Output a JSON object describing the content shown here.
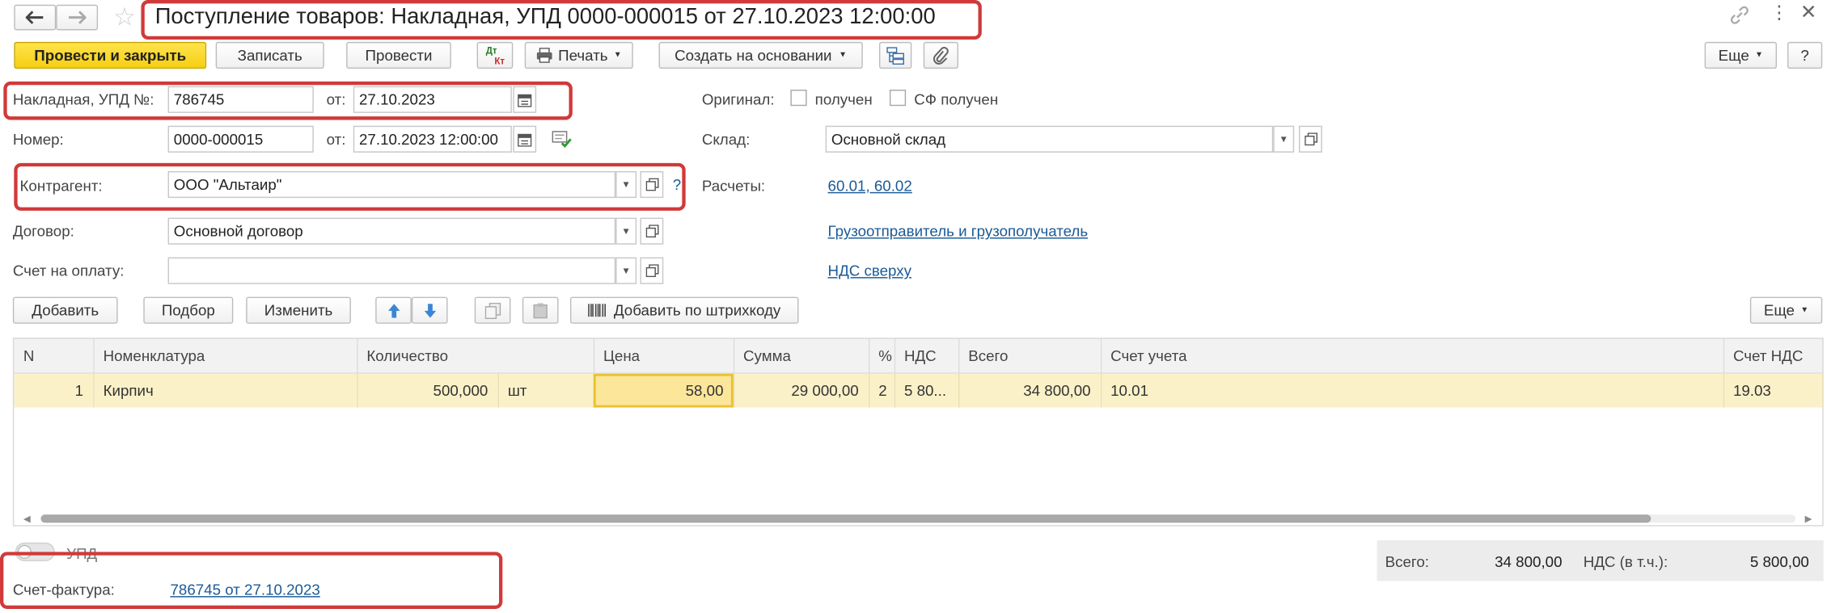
{
  "window": {
    "title": "Поступление товаров: Накладная, УПД 0000-000015 от 27.10.2023 12:00:00"
  },
  "nav": {
    "back": "back-arrow-icon",
    "forward": "forward-arrow-icon"
  },
  "toolbar": {
    "post_close": "Провести и закрыть",
    "save": "Записать",
    "post": "Провести",
    "dtkt_top": "Дт",
    "dtkt_bottom": "Кт",
    "print": "Печать",
    "create_based": "Создать на основании",
    "more": "Еще",
    "help": "?"
  },
  "header": {
    "invoice_label": "Накладная, УПД №:",
    "invoice_value": "786745",
    "from_label": "от:",
    "invoice_date": "27.10.2023",
    "original_label": "Оригинал:",
    "received_label": "получен",
    "sf_received_label": "СФ получен",
    "number_label": "Номер:",
    "number_value": "0000-000015",
    "number_from_label": "от:",
    "number_date": "27.10.2023 12:00:00",
    "warehouse_label": "Склад:",
    "warehouse_value": "Основной склад",
    "counterparty_label": "Контрагент:",
    "counterparty_value": "ООО \"Альтаир\"",
    "counterparty_help": "?",
    "settlements_label": "Расчеты:",
    "settlements_link": "60.01, 60.02",
    "contract_label": "Договор:",
    "contract_value": "Основной договор",
    "shipper_link": "Грузоотправитель и грузополучатель",
    "payment_invoice_label": "Счет на оплату:",
    "payment_invoice_value": "",
    "vat_link": "НДС сверху"
  },
  "table_toolbar": {
    "add": "Добавить",
    "pick": "Подбор",
    "change": "Изменить",
    "barcode": "Добавить по штрихкоду",
    "more": "Еще"
  },
  "table": {
    "columns": [
      "N",
      "Номенклатура",
      "Количество",
      "Цена",
      "Сумма",
      "%",
      "НДС",
      "Всего",
      "Счет учета",
      "Счет НДС"
    ],
    "rows": [
      {
        "n": "1",
        "item": "Кирпич",
        "qty": "500,000",
        "unit": "шт",
        "price": "58,00",
        "sum": "29 000,00",
        "pct": "2",
        "vat": "5 80...",
        "total": "34 800,00",
        "account": "10.01",
        "vat_account": "19.03"
      }
    ]
  },
  "footer": {
    "upd_label": "УПД",
    "sf_label": "Счет-фактура:",
    "sf_link": "786745 от 27.10.2023",
    "total_label": "Всего:",
    "total_value": "34 800,00",
    "vat_label": "НДС (в т.ч.):",
    "vat_value": "5 800,00"
  },
  "colors": {
    "primary_button": "#f6cf11",
    "link": "#1b5a96",
    "highlight_row": "#fbf1c8",
    "annotation": "#d03a3a"
  }
}
